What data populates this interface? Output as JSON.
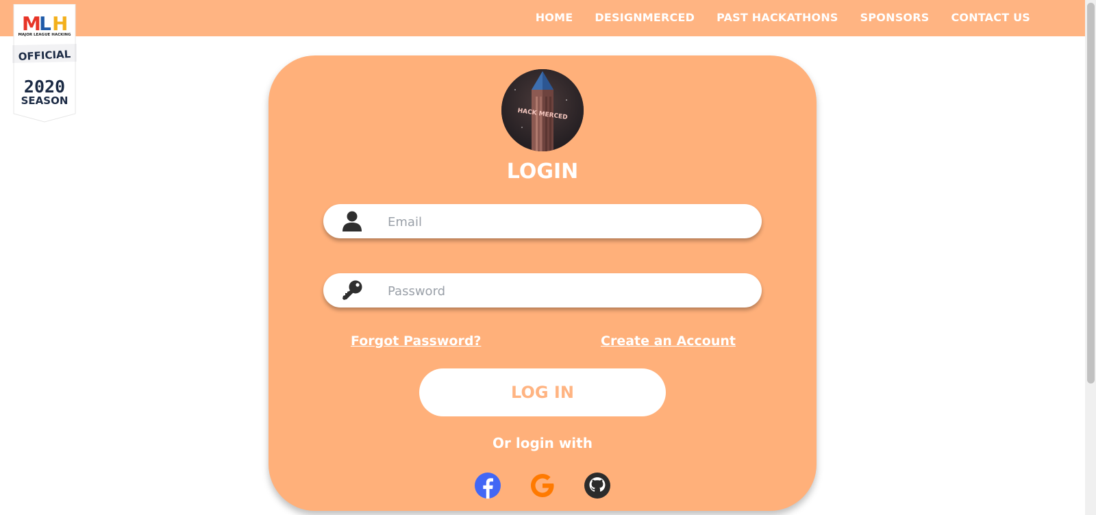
{
  "nav": {
    "items": [
      "HOME",
      "DESIGNMERCED",
      "PAST HACKATHONS",
      "SPONSORS",
      "CONTACT US"
    ]
  },
  "badge": {
    "brand": "MLH",
    "tagline": "MAJOR LEAGUE HACKING",
    "official": "OFFICIAL",
    "year": "2020",
    "season": "SEASON"
  },
  "logo": {
    "text": "HACK MERCED"
  },
  "login": {
    "title": "LOGIN",
    "email_placeholder": "Email",
    "password_placeholder": "Password",
    "forgot": "Forgot Password?",
    "create": "Create an Account",
    "button": "LOG IN",
    "or_login_with": "Or login with"
  },
  "social": [
    "facebook-icon",
    "google-icon",
    "github-icon"
  ],
  "colors": {
    "accent": "#ffb482",
    "card": "#ffb07a",
    "facebook": "#4267f5",
    "google": "#ff7a00",
    "github": "#2b2b2b"
  }
}
